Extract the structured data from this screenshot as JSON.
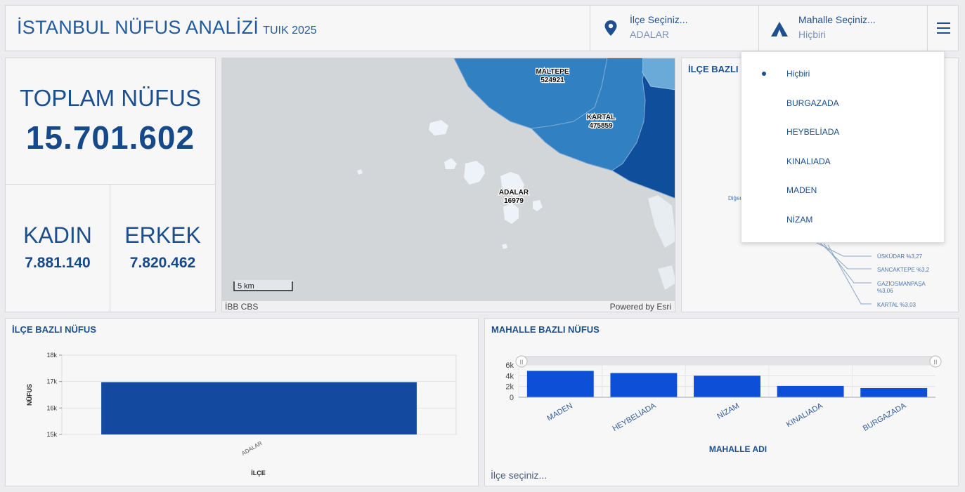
{
  "header": {
    "title": "İSTANBUL NÜFUS ANALİZİ",
    "subtitle": "TUIK 2025",
    "ilce_label": "İlçe Seçiniz...",
    "ilce_value": "ADALAR",
    "mahalle_label": "Mahalle Seçiniz...",
    "mahalle_value": "Hiçbiri"
  },
  "kpis": {
    "total_label": "TOPLAM NÜFUS",
    "total_value": "15.701.602",
    "kadin_label": "KADIN",
    "kadin_value": "7.881.140",
    "erkek_label": "ERKEK",
    "erkek_value": "7.820.462"
  },
  "map": {
    "labels": [
      {
        "name": "MALTEPE",
        "value": "524921"
      },
      {
        "name": "KARTAL",
        "value": "475859"
      },
      {
        "name": "ADALAR",
        "value": "16979"
      }
    ],
    "scale": "5 km",
    "attribution_left": "İBB CBS",
    "attribution_right": "Powered by Esri"
  },
  "pie_panel": {
    "title": "İLÇE BAZLI S",
    "other_label": "Diğer",
    "slice_labels": [
      "ÜSKÜDAR %3,27",
      "SANCAKTEPE %3,2",
      "GAZİOSMANPAŞA",
      "%3,06",
      "KARTAL %3,03"
    ]
  },
  "dropdown": {
    "items": [
      "Hiçbiri",
      "BURGAZADA",
      "HEYBELİADA",
      "KINALIADA",
      "MADEN",
      "NİZAM"
    ],
    "selected": "Hiçbiri"
  },
  "colors": {
    "accent": "#1e5aa0",
    "bar_ilce": "#13499e",
    "bar_mahalle": "#0d4fd6",
    "map_water": "#d3d6d8",
    "district_dark": "#0e4e9a",
    "district_mid": "#3180c2",
    "district_light": "#6aaad8"
  },
  "chart_data": [
    {
      "type": "bar",
      "title": "İLÇE BAZLI NÜFUS",
      "categories": [
        "ADALAR"
      ],
      "values": [
        16979
      ],
      "xlabel": "İLÇE",
      "ylabel": "NÜFUS",
      "ylim": [
        15000,
        18000
      ],
      "yticks": [
        "15k",
        "16k",
        "17k",
        "18k"
      ],
      "grid": true
    },
    {
      "type": "bar",
      "title": "MAHALLE BAZLI NÜFUS",
      "categories": [
        "MADEN",
        "HEYBELİADA",
        "NİZAM",
        "KINALIADA",
        "BURGAZADA"
      ],
      "values": [
        4900,
        4500,
        4000,
        2100,
        1700
      ],
      "xlabel": "MAHALLE ADI",
      "ylabel": "",
      "ylim": [
        0,
        6000
      ],
      "yticks": [
        "0",
        "2k",
        "4k",
        "6k"
      ],
      "grid": true,
      "footer": "İlçe seçiniz..."
    }
  ]
}
